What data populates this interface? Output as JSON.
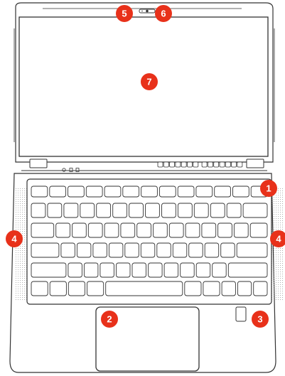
{
  "callouts": [
    {
      "number": "1",
      "color": "#e8311a"
    },
    {
      "number": "2",
      "color": "#e8311a"
    },
    {
      "number": "3",
      "color": "#e8311a"
    },
    {
      "number": "4",
      "color": "#e8311a"
    },
    {
      "number": "4",
      "color": "#e8311a"
    },
    {
      "number": "5",
      "color": "#e8311a"
    },
    {
      "number": "6",
      "color": "#e8311a"
    },
    {
      "number": "7",
      "color": "#e8311a"
    }
  ],
  "colors": {
    "outline": "#333333",
    "body_fill": "#ffffff",
    "screen_fill": "#ffffff",
    "speaker_dots": "#999999",
    "accent": "#e8311a"
  }
}
